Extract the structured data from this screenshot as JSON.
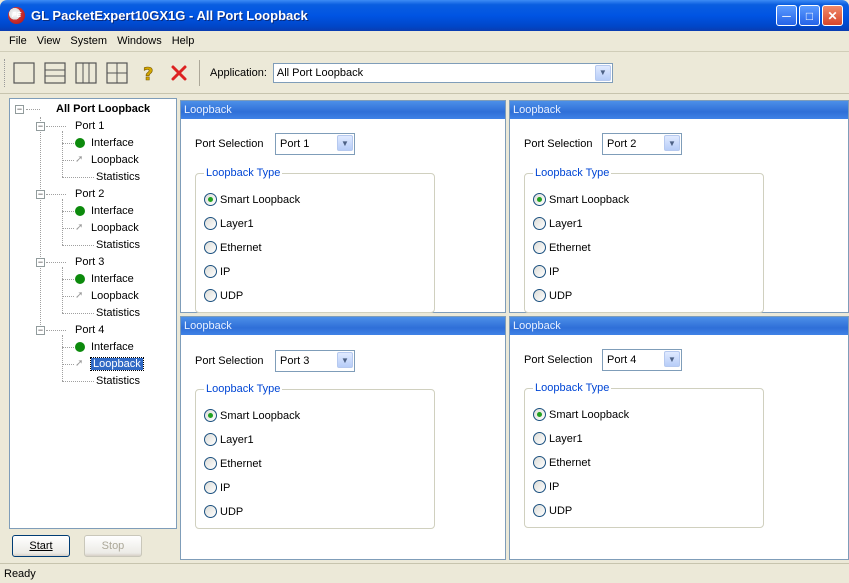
{
  "window": {
    "title": "GL PacketExpert10GX1G - All Port Loopback",
    "icon_text": "PE"
  },
  "menu": [
    "File",
    "View",
    "System",
    "Windows",
    "Help"
  ],
  "toolbar": {
    "application_label": "Application:",
    "application_value": "All Port Loopback"
  },
  "tree": {
    "root": "All Port Loopback",
    "ports": [
      {
        "label": "Port 1",
        "children": [
          "Interface",
          "Loopback",
          "Statistics"
        ]
      },
      {
        "label": "Port 2",
        "children": [
          "Interface",
          "Loopback",
          "Statistics"
        ]
      },
      {
        "label": "Port 3",
        "children": [
          "Interface",
          "Loopback",
          "Statistics"
        ]
      },
      {
        "label": "Port 4",
        "children": [
          "Interface",
          "Loopback",
          "Statistics"
        ]
      }
    ],
    "selected": "Port 4 / Loopback"
  },
  "buttons": {
    "start": "Start",
    "stop": "Stop"
  },
  "status": "Ready",
  "panes": [
    {
      "header": "Loopback",
      "port_selection_label": "Port Selection",
      "port_value": "Port 1",
      "loopback_type_label": "Loopback Type",
      "options": [
        "Smart Loopback",
        "Layer1",
        "Ethernet",
        "IP",
        "UDP"
      ],
      "selected_option": "Smart Loopback"
    },
    {
      "header": "Loopback",
      "port_selection_label": "Port Selection",
      "port_value": "Port 2",
      "loopback_type_label": "Loopback Type",
      "options": [
        "Smart Loopback",
        "Layer1",
        "Ethernet",
        "IP",
        "UDP"
      ],
      "selected_option": "Smart Loopback"
    },
    {
      "header": "Loopback",
      "port_selection_label": "Port Selection",
      "port_value": "Port 3",
      "loopback_type_label": "Loopback Type",
      "options": [
        "Smart Loopback",
        "Layer1",
        "Ethernet",
        "IP",
        "UDP"
      ],
      "selected_option": "Smart Loopback"
    },
    {
      "header": "Loopback",
      "port_selection_label": "Port Selection",
      "port_value": "Port 4",
      "loopback_type_label": "Loopback Type",
      "options": [
        "Smart Loopback",
        "Layer1",
        "Ethernet",
        "IP",
        "UDP"
      ],
      "selected_option": "Smart Loopback"
    }
  ]
}
